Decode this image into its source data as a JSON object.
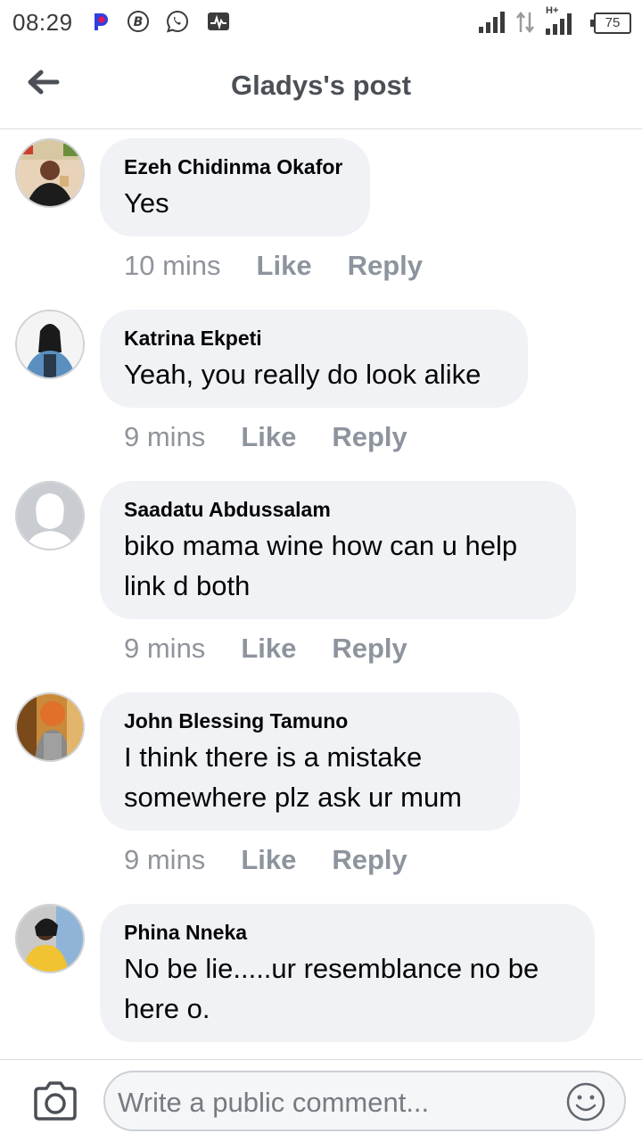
{
  "status_bar": {
    "time": "08:29",
    "network": "H+",
    "battery": "75"
  },
  "header": {
    "title": "Gladys's post"
  },
  "comments": [
    {
      "author": "Ezeh Chidinma Okafor",
      "text": "Yes",
      "time": "10 mins",
      "like": "Like",
      "reply": "Reply"
    },
    {
      "author": "Katrina Ekpeti",
      "text": "Yeah, you really do look alike",
      "time": "9 mins",
      "like": "Like",
      "reply": "Reply"
    },
    {
      "author": "Saadatu Abdussalam",
      "text": "biko mama wine how can u help link d both",
      "time": "9 mins",
      "like": "Like",
      "reply": "Reply"
    },
    {
      "author": "John Blessing Tamuno",
      "text": "I think there is a mistake somewhere plz ask ur mum",
      "time": "9 mins",
      "like": "Like",
      "reply": "Reply"
    },
    {
      "author": "Phina Nneka",
      "text": "No be lie.....ur resemblance no be here o.",
      "time": "",
      "like": "",
      "reply": ""
    }
  ],
  "composer": {
    "placeholder": "Write a public comment..."
  }
}
